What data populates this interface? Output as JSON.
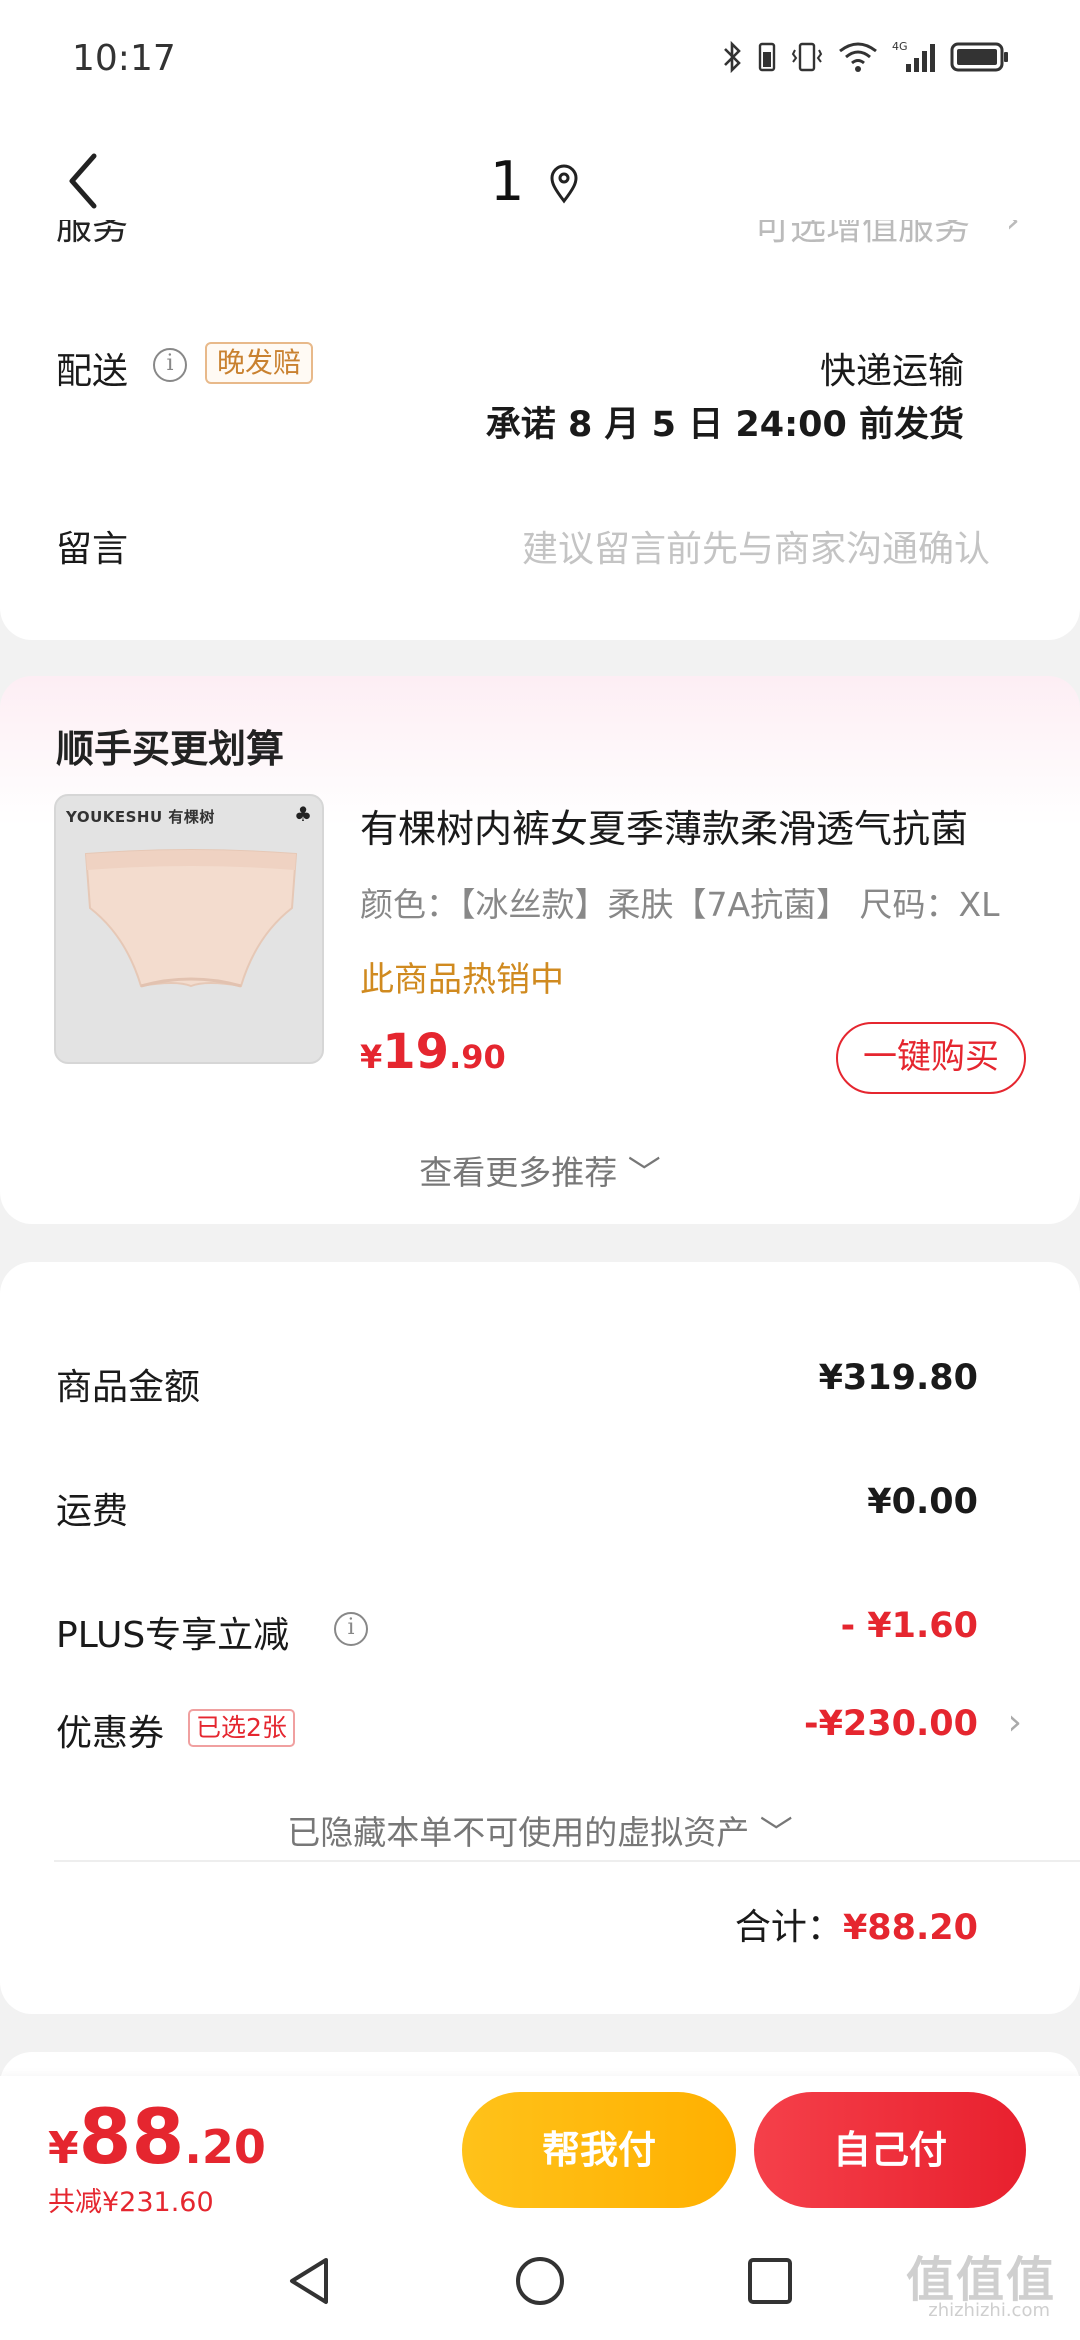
{
  "status": {
    "time": "10:17",
    "network": "4G"
  },
  "nav": {
    "title": "1"
  },
  "delivery": {
    "clipped_label": "服务",
    "clipped_value": "可选增值服务",
    "label": "配送",
    "badge": "晚发赔",
    "method": "快递运输",
    "promise": "承诺 8 月 5 日 24:00 前发货"
  },
  "note": {
    "label": "留言",
    "placeholder": "建议留言前先与商家沟通确认"
  },
  "recommend": {
    "title": "顺手买更划算",
    "brand_text": "YOUKESHU 有棵树",
    "product_name": "有棵树内裤女夏季薄款柔滑透气抗菌",
    "spec": "颜色：【冰丝款】柔肤【7A抗菌】  尺码：XL",
    "hot": "此商品热销中",
    "price_currency": "¥",
    "price_int": "19",
    "price_dec": ".90",
    "buy_label": "一键购买",
    "more_label": "查看更多推荐"
  },
  "summary": {
    "goods_label": "商品金额",
    "goods_value": "¥319.80",
    "shipping_label": "运费",
    "shipping_value": "¥0.00",
    "plus_label": "PLUS专享立减",
    "plus_value": "- ¥1.60",
    "coupon_label": "优惠券",
    "coupon_badge": "已选2张",
    "coupon_value": "-¥230.00",
    "hidden_assets": "已隐藏本单不可使用的虚拟资产",
    "total_label": "合计：",
    "total_value": "¥88.20"
  },
  "paybar": {
    "currency": "¥",
    "int": "88",
    "dec": ".20",
    "saved": "共减¥231.60",
    "help_pay": "帮我付",
    "self_pay": "自己付"
  },
  "watermark": {
    "main": "值值值",
    "sub": "zhizhizhi.com"
  },
  "colors": {
    "accent_red": "#e5262f",
    "accent_yellow": "#ffb000",
    "hot_orange": "#d08a1f"
  }
}
